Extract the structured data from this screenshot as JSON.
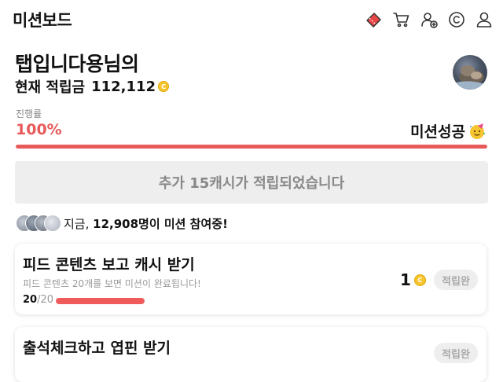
{
  "header": {
    "title": "미션보드",
    "icons": [
      "ticket-icon",
      "cart-icon",
      "add-user-icon",
      "cash-icon",
      "profile-icon"
    ]
  },
  "user": {
    "name": "탭입니다용님의",
    "points_label": "현재 적립금",
    "points_value": "112,112",
    "coin_symbol": "C"
  },
  "progress": {
    "label": "진행률",
    "percent_text": "100%",
    "percent": 100,
    "status": "미션성공",
    "accent_color": "#e85a5a"
  },
  "reward_banner": {
    "text": "추가 15캐시가 적립되었습니다"
  },
  "participants": {
    "prefix": "지금, ",
    "count": "12,908명",
    "suffix": "이 미션 참여중!"
  },
  "missions": [
    {
      "title": "피드 콘텐츠 보고 캐시 받기",
      "description": "피드 콘텐츠 20개를 보면 미션이 완료됩니다!",
      "progress_current": "20",
      "progress_total": "/20",
      "progress_fraction": 1.0,
      "reward": "1",
      "status": "적립완"
    },
    {
      "title": "출석체크하고 엽핀 받기",
      "status": "적립완"
    }
  ]
}
